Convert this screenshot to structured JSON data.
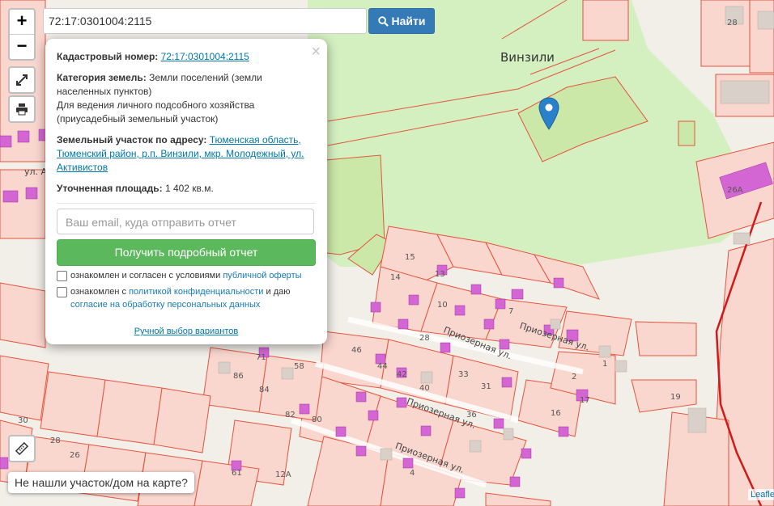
{
  "search": {
    "value": "72:17:0301004:2115",
    "button_label": "Найти"
  },
  "zoom": {
    "in_label": "+",
    "out_label": "−"
  },
  "map": {
    "place_name": "Винзили",
    "streets": [
      "ул. Активистов",
      "Приозерная ул.",
      "Приозерная ул.",
      "Приозерная ул.",
      "Приозерная ул."
    ],
    "house_numbers": [
      "28",
      "26А",
      "15",
      "14",
      "10",
      "13",
      "7",
      "28",
      "46",
      "44",
      "42",
      "58",
      "40",
      "36",
      "33",
      "31",
      "2",
      "1",
      "17",
      "19",
      "16",
      "82",
      "80",
      "86",
      "84",
      "71",
      "30",
      "28",
      "26",
      "12А",
      "61",
      "4"
    ]
  },
  "popup": {
    "cadastral_label": "Кадастровый номер:",
    "cadastral_number": "72:17:0301004:2115",
    "category_label": "Категория земель:",
    "category_value": "Земли поселений (земли населенных пунктов)",
    "usage": "Для ведения личного подсобного хозяйства (приусадебный земельный участок)",
    "address_label": "Земельный участок по адресу:",
    "address_value": "Тюменская область, Тюменский район, р.п. Винзили, мкр. Молодежный, ул. Активистов",
    "area_label": "Уточненная площадь:",
    "area_value": "1 402 кв.м.",
    "email_placeholder": "Ваш email, куда отправить отчет",
    "report_button": "Получить подробный отчет",
    "consent1_text": "ознакомлен и согласен с условиями",
    "consent1_link": "публичной оферты",
    "consent2_text": "ознакомлен с",
    "consent2_link": "политикой конфиденциальности",
    "consent2_mid": "и даю",
    "consent2_link2": "согласие на обработку персональных данных",
    "manual_link": "Ручной выбор вариантов",
    "close_label": "×"
  },
  "not_found_label": "Не нашли участок/дом на карте?",
  "leaflet_label": "Leaflet",
  "colors": {
    "parcel_fill": "#f9d7cf",
    "parcel_stroke": "#e5533d",
    "green_area": "#d4f0c0",
    "building": "#d466d4",
    "search_button": "#337ab7",
    "report_button": "#5cb85c",
    "marker": "#2a81cb"
  }
}
